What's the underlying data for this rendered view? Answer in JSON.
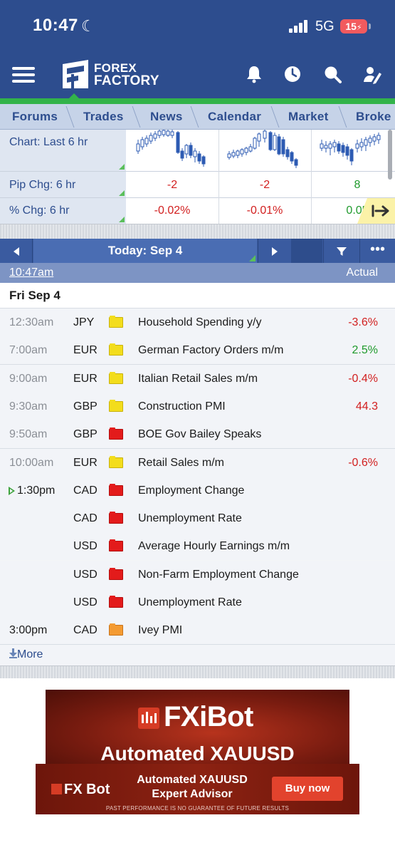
{
  "status_bar": {
    "time": "10:47",
    "network": "5G",
    "battery": "15"
  },
  "app": {
    "logo_line1": "FOREX",
    "logo_line2": "FACTORY"
  },
  "nav_tabs": [
    "Forums",
    "Trades",
    "News",
    "Calendar",
    "Market",
    "Broke"
  ],
  "markets": {
    "rows": [
      {
        "label": "Chart: Last 6 hr"
      },
      {
        "label": "Pip Chg: 6 hr",
        "values": [
          "-2",
          "-2",
          "8"
        ]
      },
      {
        "label": "% Chg: 6 hr",
        "values": [
          "-0.02%",
          "-0.01%",
          "0.05"
        ]
      }
    ]
  },
  "calendar": {
    "today_label": "Today: Sep 4",
    "current_time": "10:47am",
    "actual_header": "Actual",
    "day_label": "Fri Sep 4",
    "events": [
      {
        "time": "12:30am",
        "currency": "JPY",
        "impact": "yellow",
        "name": "Household Spending y/y",
        "actual": "-3.6%",
        "actual_color": "red"
      },
      {
        "time": "7:00am",
        "currency": "EUR",
        "impact": "yellow",
        "name": "German Factory Orders m/m",
        "actual": "2.5%",
        "actual_color": "green"
      },
      {
        "time": "9:00am",
        "currency": "EUR",
        "impact": "yellow",
        "name": "Italian Retail Sales m/m",
        "actual": "-0.4%",
        "actual_color": "red"
      },
      {
        "time": "9:30am",
        "currency": "GBP",
        "impact": "yellow",
        "name": "Construction PMI",
        "actual": "44.3",
        "actual_color": "red"
      },
      {
        "time": "9:50am",
        "currency": "GBP",
        "impact": "red",
        "name": "BOE Gov Bailey Speaks",
        "actual": "",
        "actual_color": ""
      },
      {
        "time": "10:00am",
        "currency": "EUR",
        "impact": "yellow",
        "name": "Retail Sales m/m",
        "actual": "-0.6%",
        "actual_color": "red"
      },
      {
        "time": "1:30pm",
        "currency": "CAD",
        "impact": "red",
        "name": "Employment Change",
        "actual": "",
        "actual_color": ""
      },
      {
        "time": "",
        "currency": "CAD",
        "impact": "red",
        "name": "Unemployment Rate",
        "actual": "",
        "actual_color": ""
      },
      {
        "time": "",
        "currency": "USD",
        "impact": "red",
        "name": "Average Hourly Earnings m/m",
        "actual": "",
        "actual_color": ""
      },
      {
        "time": "",
        "currency": "USD",
        "impact": "red",
        "name": "Non-Farm Employment Change",
        "actual": "",
        "actual_color": ""
      },
      {
        "time": "",
        "currency": "USD",
        "impact": "red",
        "name": "Unemployment Rate",
        "actual": "",
        "actual_color": ""
      },
      {
        "time": "3:00pm",
        "currency": "CAD",
        "impact": "orange",
        "name": "Ivey PMI",
        "actual": "",
        "actual_color": ""
      }
    ],
    "more_label": "More"
  },
  "ads": {
    "ad1_logo": "FXiBot",
    "ad1_subtitle": "Automated XAUUSD",
    "ad2_logo": "FX Bot",
    "ad2_title": "Automated XAUUSD Expert Advisor",
    "ad2_button": "Buy now",
    "ad2_disclaimer": "PAST PERFORMANCE IS NO GUARANTEE OF FUTURE RESULTS"
  }
}
